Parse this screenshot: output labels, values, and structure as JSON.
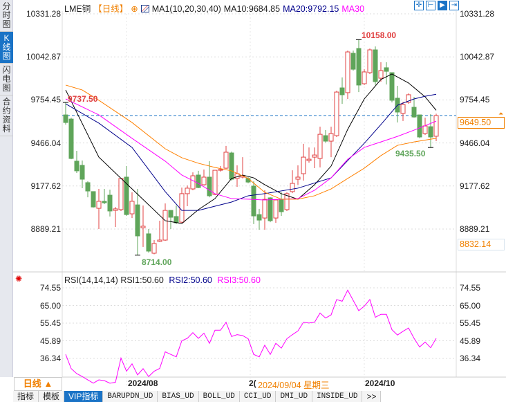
{
  "left_tabs": [
    "分时图",
    "K线图",
    "闪电图",
    "合约资料"
  ],
  "header": {
    "symbol": "LME铜",
    "period": "【日线】",
    "ma_name": "MA1(10,20,30,40)",
    "ma10": "MA10:9684.85",
    "ma20": "MA20:9792.15",
    "ma30": "MA30"
  },
  "toolbar_icons": [
    "crosshair-icon",
    "range-icon",
    "play-icon",
    "exit-icon"
  ],
  "price_axis": [
    "10331.28",
    "10042.87",
    "9754.45",
    "9466.04",
    "9177.62",
    "8889.21"
  ],
  "current_price": "9649.50",
  "lower_box": "8832.14",
  "annotations": {
    "high": "10158.00",
    "left_high": "9737.50",
    "low": "8714.00",
    "recent_low": "9435.50"
  },
  "rsi": {
    "title": "RSI(14,14,14)",
    "rsi1": "RSI1:50.60",
    "rsi2": "RSI2:50.60",
    "rsi3": "RSI3:50.60",
    "axis": [
      "74.55",
      "65.00",
      "55.45",
      "45.89",
      "36.34"
    ]
  },
  "period_button": "日线 ▲",
  "dates": {
    "d1": "2024/08",
    "d2": "2(",
    "d3": "2024/10",
    "crosshair": "2024/09/04 星期三"
  },
  "bottom_tabs": [
    "指标",
    "模板",
    "VIP指标",
    "BARUPDN_UD",
    "BIAS_UD",
    "BOLL_UD",
    "CCI_UD",
    "DMI_UD",
    "INSIDE_UD",
    ">>"
  ],
  "colors": {
    "up": "#e04040",
    "down": "#5fa55a",
    "ma10": "#000000",
    "ma20": "#00008b",
    "ma30": "#ff00ff",
    "ma40": "#ff8000",
    "accent": "#1a73c6"
  },
  "chart_data": {
    "type": "candlestick",
    "ylim": [
      8714,
      10331.28
    ],
    "candles": [
      [
        9654,
        9603,
        9737.5,
        9589
      ],
      [
        9626,
        9362,
        9636,
        9357
      ],
      [
        9344,
        9279,
        9413,
        9265
      ],
      [
        9316,
        9223,
        9348,
        9163
      ],
      [
        9200,
        9144,
        9209,
        9102
      ],
      [
        9140,
        9037,
        9140,
        9033
      ],
      [
        9028,
        9075,
        9158,
        8889
      ],
      [
        9075,
        9065,
        9158,
        9056
      ],
      [
        9116,
        9010,
        9153,
        8973
      ],
      [
        9014,
        9024,
        9037,
        8903
      ],
      [
        9019,
        9228,
        9228,
        9010
      ],
      [
        9237,
        8986,
        9311,
        8977
      ],
      [
        8991,
        9075,
        9135,
        8963
      ],
      [
        9051,
        8843,
        9158,
        8714
      ],
      [
        8898,
        8908,
        9047,
        8769
      ],
      [
        8857,
        8741,
        8889,
        8731
      ],
      [
        8727,
        8792,
        8815,
        8720
      ],
      [
        8806,
        8815,
        8945,
        8801
      ],
      [
        8815,
        9014,
        9061,
        8810
      ],
      [
        9014,
        8968,
        9014,
        8889
      ],
      [
        8973,
        8931,
        9047,
        8922
      ],
      [
        8935,
        9126,
        9167,
        8931
      ],
      [
        9126,
        9163,
        9181,
        9042
      ],
      [
        9158,
        9246,
        9269,
        9149
      ],
      [
        9251,
        9167,
        9279,
        9163
      ],
      [
        9186,
        9237,
        9288,
        9181
      ],
      [
        9237,
        9112,
        9344,
        9102
      ],
      [
        9121,
        9283,
        9283,
        9116
      ],
      [
        9283,
        9288,
        9311,
        9274
      ],
      [
        9297,
        9404,
        9446,
        9293
      ],
      [
        9399,
        9223,
        9408,
        9214
      ],
      [
        9228,
        9260,
        9316,
        9172
      ],
      [
        9237,
        9246,
        9371,
        9228
      ],
      [
        9228,
        9204,
        9237,
        9195
      ],
      [
        9177,
        8977,
        9209,
        8922
      ],
      [
        8986,
        8949,
        9024,
        8884
      ],
      [
        8963,
        9088,
        9149,
        8884
      ],
      [
        9098,
        8945,
        9102,
        8935
      ],
      [
        8963,
        9084,
        9088,
        8931
      ],
      [
        9084,
        9005,
        9135,
        8977
      ],
      [
        9019,
        9126,
        9135,
        9010
      ],
      [
        9140,
        9195,
        9283,
        9130
      ],
      [
        9223,
        9237,
        9316,
        9186
      ],
      [
        9260,
        9371,
        9460,
        9214
      ],
      [
        9348,
        9357,
        9436,
        9334
      ],
      [
        9371,
        9385,
        9436,
        9297
      ],
      [
        9362,
        9524,
        9575,
        9302
      ],
      [
        9515,
        9478,
        9552,
        9469
      ],
      [
        9478,
        9529,
        9575,
        9371
      ],
      [
        9515,
        9807,
        9816,
        9506
      ],
      [
        9835,
        9789,
        9905,
        9728
      ],
      [
        9803,
        10076,
        10085,
        9761
      ],
      [
        10067,
        9960,
        10085,
        9951
      ],
      [
        10099,
        9854,
        10158,
        9807
      ],
      [
        9863,
        9942,
        9960,
        9854
      ],
      [
        9937,
        10090,
        10099,
        9928
      ],
      [
        10090,
        9877,
        10113,
        9854
      ],
      [
        9900,
        9951,
        10007,
        9877
      ],
      [
        9970,
        9946,
        10007,
        9858
      ],
      [
        9937,
        9752,
        9937,
        9738
      ],
      [
        9766,
        9673,
        9849,
        9603
      ],
      [
        9664,
        9724,
        9742,
        9613
      ],
      [
        9738,
        9789,
        9798,
        9728
      ],
      [
        9705,
        9640,
        9775,
        9636
      ],
      [
        9654,
        9506,
        9654,
        9497
      ],
      [
        9529,
        9580,
        9636,
        9520
      ],
      [
        9575,
        9506,
        9659,
        9435.5
      ],
      [
        9511,
        9649.5,
        9662,
        9478
      ]
    ],
    "ma": {
      "ma10": {
        "idx": [
          1,
          7,
          13,
          19,
          22,
          25,
          28,
          31,
          33,
          35,
          37,
          40,
          43,
          46,
          49,
          52,
          55,
          58,
          60,
          63,
          66,
          68
        ],
        "values": [
          9821,
          9371,
          9158,
          8945,
          8926,
          9019,
          9093,
          9228,
          9251,
          9232,
          9186,
          9126,
          9089,
          9186,
          9311,
          9557,
          9761,
          9891,
          9928,
          9868,
          9775,
          9685
        ]
      },
      "ma20": {
        "idx": [
          1,
          7,
          13,
          19,
          22,
          25,
          28,
          31,
          34,
          37,
          43,
          49,
          55,
          58,
          61,
          64,
          66,
          68
        ],
        "values": [
          9728,
          9599,
          9436,
          9140,
          9014,
          9014,
          9042,
          9070,
          9112,
          9126,
          9163,
          9232,
          9464,
          9589,
          9719,
          9761,
          9779,
          9792
        ]
      },
      "ma30": {
        "idx": [
          1,
          7,
          13,
          19,
          22,
          25,
          28,
          31,
          34,
          37,
          43,
          46,
          49,
          52,
          55,
          58,
          61,
          64,
          68
        ],
        "values": [
          9761,
          9654,
          9497,
          9344,
          9251,
          9195,
          9126,
          9093,
          9089,
          9084,
          9093,
          9149,
          9232,
          9357,
          9436,
          9473,
          9510,
          9552,
          9612
        ]
      },
      "ma40": {
        "idx": [
          1,
          4,
          7,
          13,
          19,
          22,
          25,
          28,
          31,
          34,
          37,
          40,
          43,
          46,
          49,
          52,
          55,
          58,
          61,
          64,
          68
        ],
        "values": [
          9854,
          9821,
          9752,
          9603,
          9427,
          9367,
          9330,
          9302,
          9279,
          9228,
          9135,
          9089,
          9089,
          9112,
          9158,
          9228,
          9297,
          9381,
          9450,
          9473,
          9497
        ]
      }
    },
    "rsi_values": [
      38.5,
      30.8,
      28.1,
      26.5,
      24.7,
      22.9,
      24.7,
      24.3,
      22.9,
      23.4,
      36.5,
      29.4,
      33.4,
      27.4,
      30.8,
      26.5,
      29.4,
      30.9,
      39.9,
      38.5,
      37.2,
      45.9,
      47.2,
      50.3,
      47.2,
      50.0,
      44.5,
      51.6,
      51.6,
      55.9,
      48.2,
      49.2,
      48.7,
      47.0,
      38.5,
      37.2,
      43.5,
      38.5,
      44.5,
      41.9,
      47.0,
      49.2,
      51.2,
      55.9,
      55.5,
      55.9,
      60.9,
      58.2,
      59.9,
      68.2,
      67.3,
      73.3,
      67.7,
      62.2,
      64.6,
      68.2,
      58.6,
      60.2,
      60.2,
      51.9,
      49.0,
      51.0,
      52.8,
      47.2,
      42.5,
      45.2,
      42.1,
      47.2
    ],
    "rsi_ylim": [
      36.34,
      74.55
    ]
  }
}
